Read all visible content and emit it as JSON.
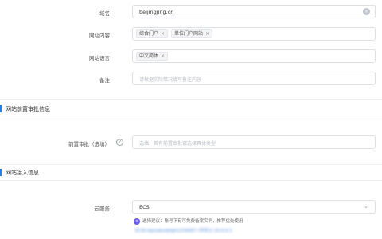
{
  "form": {
    "domain": {
      "label": "域名",
      "value": "beijingjing.cn"
    },
    "site_content": {
      "label": "网站内容",
      "tags": [
        "综合门户",
        "单位门户网站"
      ]
    },
    "site_language": {
      "label": "网站语言",
      "tags": [
        "中文简体"
      ]
    },
    "remark": {
      "label": "备注",
      "placeholder": "请根据实际情况填写备注内容"
    }
  },
  "section_approval": {
    "title": "网站前置审批信息"
  },
  "approval": {
    "label": "前置审批（选填）",
    "placeholder": "选填，若有前置审批请选择具体类型"
  },
  "section_access": {
    "title": "网站接入信息"
  },
  "cloud": {
    "label": "云服务",
    "value": "ECS",
    "note": "选择建议：账号下有可免费备案实例，推荐优先使用",
    "link": "ECS/i-bp1abcdefgh1234567 (华东1) 10.0.0.1"
  },
  "icons": {
    "help": "?",
    "remove": "×",
    "clear": "×",
    "chevron": "⌄",
    "star": "★"
  }
}
